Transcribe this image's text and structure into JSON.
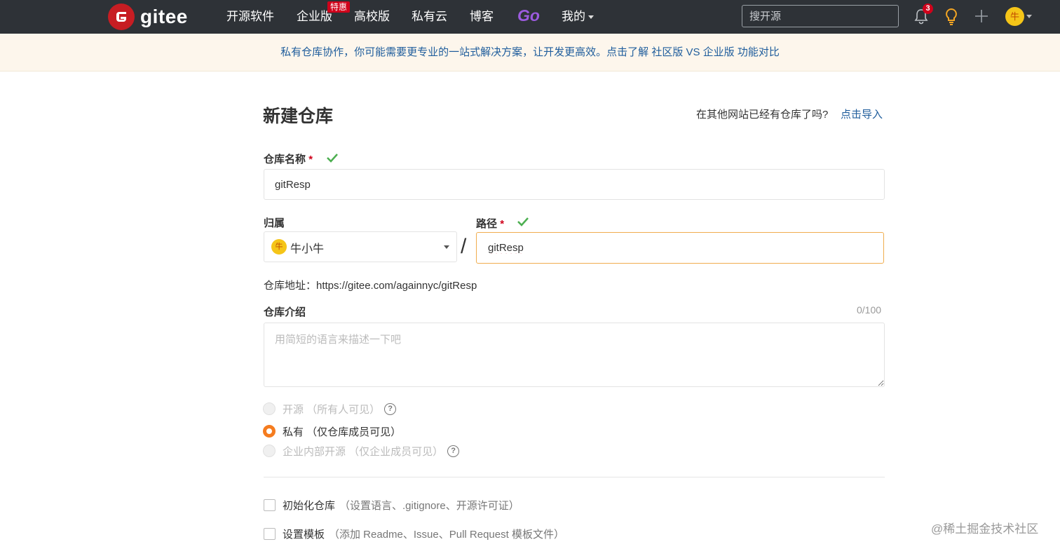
{
  "nav": {
    "logo_text": "gitee",
    "items": [
      "开源软件",
      "企业版",
      "高校版",
      "私有云",
      "博客"
    ],
    "hot_badge": "特惠",
    "go_label": "Go",
    "mine_label": "我的",
    "search_placeholder": "搜开源",
    "notifications_count": "3",
    "avatar_text": "牛"
  },
  "banner": {
    "text": "私有仓库协作，你可能需要更专业的一站式解决方案，让开发更高效。点击了解 社区版 VS 企业版 功能对比"
  },
  "form": {
    "title": "新建仓库",
    "import_prompt": "在其他网站已经有仓库了吗?",
    "import_link": "点击导入",
    "repo_name_label": "仓库名称",
    "required_mark": "*",
    "repo_name_value": "gitResp",
    "owner_label": "归属",
    "owner_avatar": "牛",
    "owner_value": "牛小牛",
    "slash": "/",
    "path_label": "路径",
    "path_value": "gitResp",
    "repo_url": "仓库地址：https://gitee.com/againnyc/gitResp",
    "desc_label": "仓库介绍",
    "desc_count": "0/100",
    "desc_placeholder": "用简短的语言来描述一下吧",
    "visibility": {
      "public": "开源 （所有人可见）",
      "private": "私有 （仅仓库成员可见）",
      "internal": "企业内部开源 （仅企业成员可见）"
    },
    "init_repo": {
      "label": "初始化仓库",
      "hint": "（设置语言、.gitignore、开源许可证）"
    },
    "template": {
      "label": "设置模板",
      "hint": "（添加 Readme、Issue、Pull Request 模板文件）"
    }
  },
  "watermark": "@稀土掘金技术社区"
}
